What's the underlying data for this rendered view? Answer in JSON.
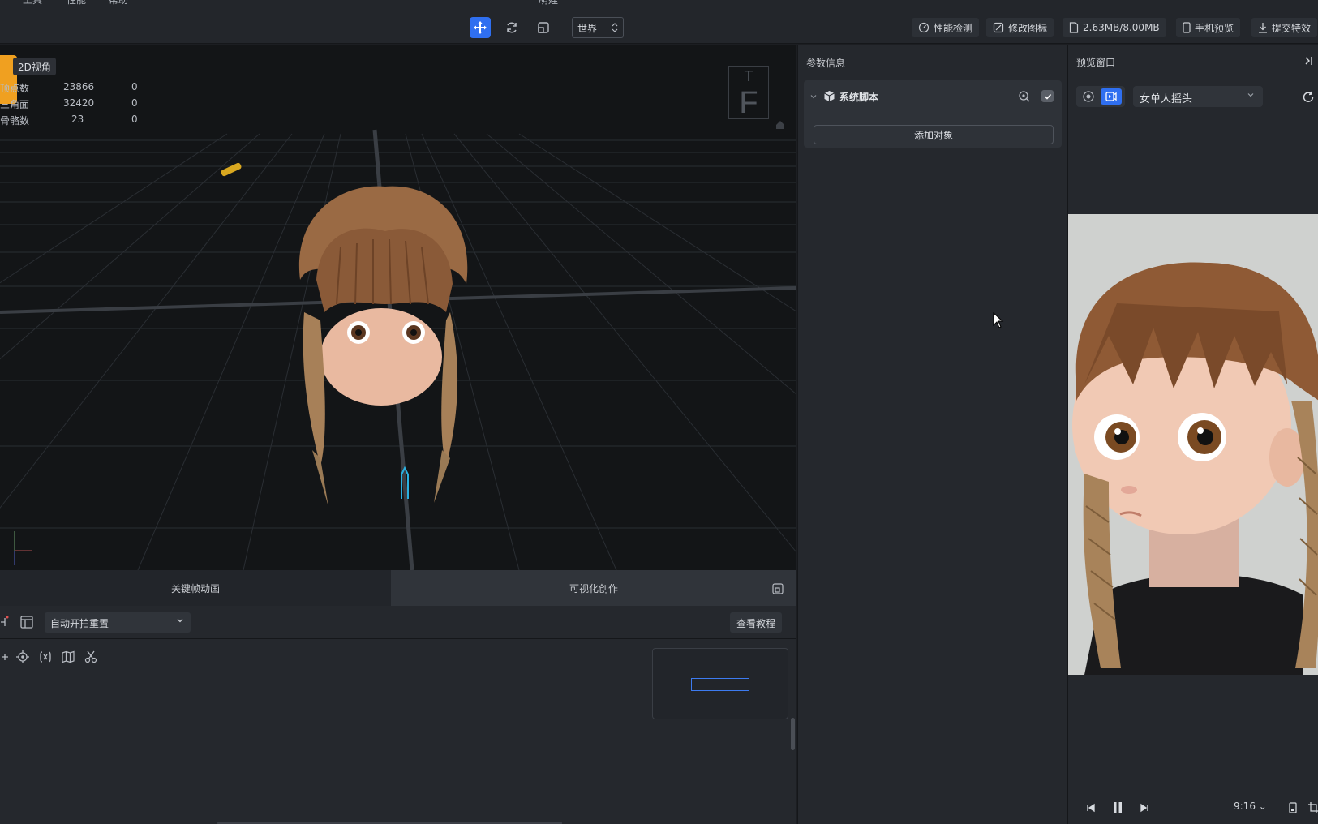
{
  "menu": {
    "items": [
      "工具",
      "性能",
      "帮助"
    ],
    "title": "萌娃"
  },
  "toolbar": {
    "coord_space": "世界",
    "actions": [
      "性能检测",
      "修改图标",
      "2.63MB/8.00MB",
      "手机预览",
      "提交特效"
    ]
  },
  "viewport": {
    "view_mode_label": "2D视角",
    "stats": [
      {
        "label": "顶点数",
        "value": "23866",
        "selected": "0"
      },
      {
        "label": "三角面",
        "value": "32420",
        "selected": "0"
      },
      {
        "label": "骨骼数",
        "value": "23",
        "selected": "0"
      }
    ],
    "gizmo_top": "T",
    "gizmo_front": "F"
  },
  "bottom": {
    "tabs": [
      "关键帧动画",
      "可视化创作"
    ],
    "trigger_select": "自动开拍重置",
    "tutorial_button": "查看教程"
  },
  "params": {
    "title": "参数信息",
    "script_name": "系统脚本",
    "add_object": "添加对象"
  },
  "preview": {
    "title": "预览窗口",
    "effect_select": "女单人摇头",
    "ratio": "9:16"
  },
  "colors": {
    "accent": "#2f6ff0",
    "orange": "#f0a020",
    "bg": "#1c1e22"
  }
}
